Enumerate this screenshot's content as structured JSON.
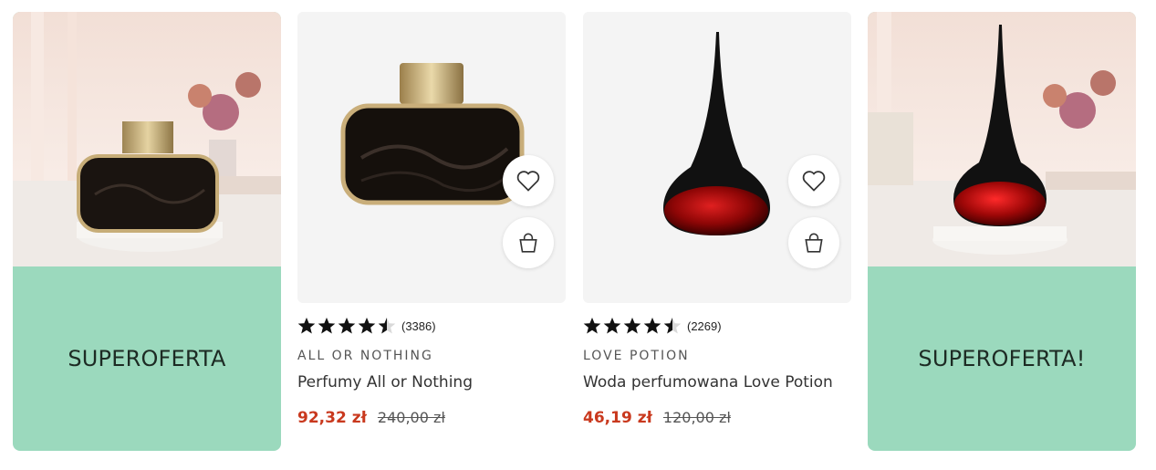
{
  "promos": [
    {
      "text": "SUPEROFERTA"
    },
    {
      "text": "SUPEROFERTA!"
    }
  ],
  "products": [
    {
      "rating": 4.5,
      "review_count": "(3386)",
      "brand": "ALL OR NOTHING",
      "name": "Perfumy All or Nothing",
      "price_now": "92,32 zł",
      "price_old": "240,00 zł"
    },
    {
      "rating": 4.5,
      "review_count": "(2269)",
      "brand": "LOVE POTION",
      "name": "Woda perfumowana Love Potion",
      "price_now": "46,19 zł",
      "price_old": "120,00 zł"
    }
  ],
  "icons": {
    "wishlist": "heart-icon",
    "cart": "shopping-bag-icon",
    "rating": "star-icon"
  },
  "colors": {
    "promo_bg": "#9bd9bd",
    "price_accent": "#c9391e"
  }
}
